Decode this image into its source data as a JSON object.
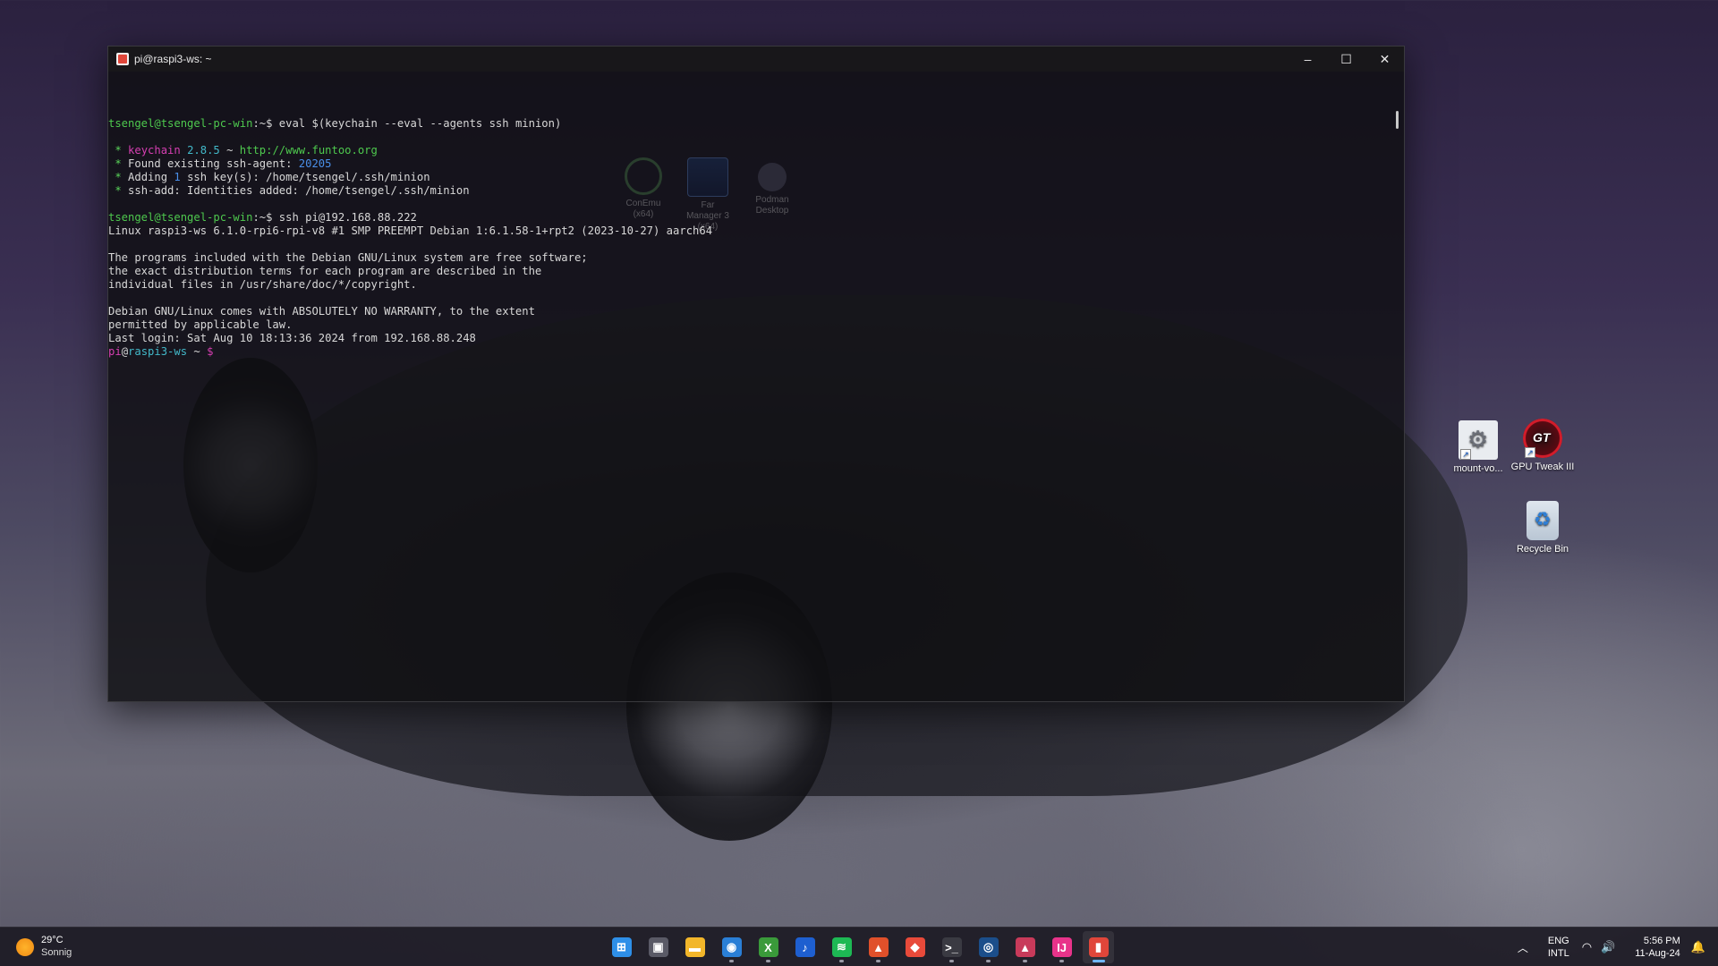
{
  "window": {
    "title": "pi@raspi3-ws: ~",
    "controls": {
      "minimize": "–",
      "maximize": "☐",
      "close": "✕"
    }
  },
  "terminal_lines": [
    [
      {
        "t": "tsengel@tsengel-pc-win",
        "c": "g"
      },
      {
        "t": ":~$ ",
        "c": "w"
      },
      {
        "t": "eval $(keychain --eval --agents ssh minion)",
        "c": "w"
      }
    ],
    [],
    [
      {
        "t": " * ",
        "c": "gb"
      },
      {
        "t": "keychain",
        "c": "m"
      },
      {
        "t": " ",
        "c": "w"
      },
      {
        "t": "2.8.5",
        "c": "c"
      },
      {
        "t": " ~ ",
        "c": "w"
      },
      {
        "t": "http://www.funtoo.org",
        "c": "g"
      }
    ],
    [
      {
        "t": " * ",
        "c": "gb"
      },
      {
        "t": "Found existing ssh-agent: ",
        "c": "w"
      },
      {
        "t": "20205",
        "c": "b"
      }
    ],
    [
      {
        "t": " * ",
        "c": "gb"
      },
      {
        "t": "Adding ",
        "c": "w"
      },
      {
        "t": "1",
        "c": "b"
      },
      {
        "t": " ssh key(s): /home/tsengel/.ssh/minion",
        "c": "w"
      }
    ],
    [
      {
        "t": " * ",
        "c": "gb"
      },
      {
        "t": "ssh-add: Identities added: /home/tsengel/.ssh/minion",
        "c": "w"
      }
    ],
    [],
    [
      {
        "t": "tsengel@tsengel-pc-win",
        "c": "g"
      },
      {
        "t": ":~$ ",
        "c": "w"
      },
      {
        "t": "ssh pi@192.168.88.222",
        "c": "w"
      }
    ],
    [
      {
        "t": "Linux raspi3-ws 6.1.0-rpi6-rpi-v8 #1 SMP PREEMPT Debian 1:6.1.58-1+rpt2 (2023-10-27) aarch64",
        "c": "w"
      }
    ],
    [],
    [
      {
        "t": "The programs included with the Debian GNU/Linux system are free software;",
        "c": "w"
      }
    ],
    [
      {
        "t": "the exact distribution terms for each program are described in the",
        "c": "w"
      }
    ],
    [
      {
        "t": "individual files in /usr/share/doc/*/copyright.",
        "c": "w"
      }
    ],
    [],
    [
      {
        "t": "Debian GNU/Linux comes with ABSOLUTELY NO WARRANTY, to the extent",
        "c": "w"
      }
    ],
    [
      {
        "t": "permitted by applicable law.",
        "c": "w"
      }
    ],
    [
      {
        "t": "Last login: Sat Aug 10 18:13:36 2024 from 192.168.88.248",
        "c": "w"
      }
    ],
    [
      {
        "t": "pi",
        "c": "m"
      },
      {
        "t": "@",
        "c": "w"
      },
      {
        "t": "raspi3-ws",
        "c": "c"
      },
      {
        "t": " ~ ",
        "c": "w"
      },
      {
        "t": "$",
        "c": "m"
      }
    ]
  ],
  "ghost_icons": [
    {
      "label": "ConEmu (x64)",
      "icon": "conemu-icon"
    },
    {
      "label": "Far Manager 3 (x64)",
      "icon": "far-manager-icon"
    },
    {
      "label": "Podman Desktop",
      "icon": "podman-icon"
    }
  ],
  "desktop_icons": {
    "mount": {
      "label": "mount-vo...",
      "icon": "gear-icon"
    },
    "gpu": {
      "label": "GPU Tweak III",
      "icon": "gpu-tweak-icon"
    },
    "bin": {
      "label": "Recycle Bin",
      "icon": "recycle-bin-icon"
    }
  },
  "weather": {
    "temp": "29°C",
    "condition": "Sonnig"
  },
  "taskbar_apps": [
    {
      "name": "start",
      "glyph": "⊞",
      "color": "#2e8fe8",
      "active": false,
      "running": false
    },
    {
      "name": "task-view",
      "glyph": "▣",
      "color": "#5a5a66",
      "active": false,
      "running": false
    },
    {
      "name": "file-explorer",
      "glyph": "▬",
      "color": "#f2b62a",
      "active": false,
      "running": false
    },
    {
      "name": "edge-browser",
      "glyph": "◉",
      "color": "#2a7fd6",
      "active": false,
      "running": true
    },
    {
      "name": "xbox",
      "glyph": "X",
      "color": "#3a9a3a",
      "active": false,
      "running": true
    },
    {
      "name": "tiktok-music",
      "glyph": "♪",
      "color": "#1e5fd0",
      "active": false,
      "running": false
    },
    {
      "name": "spotify",
      "glyph": "≋",
      "color": "#1db954",
      "active": false,
      "running": true
    },
    {
      "name": "brave-browser",
      "glyph": "▲",
      "color": "#e0502a",
      "active": false,
      "running": true
    },
    {
      "name": "maps",
      "glyph": "◆",
      "color": "#e84a3a",
      "active": false,
      "running": false
    },
    {
      "name": "windows-terminal",
      "glyph": ">_",
      "color": "#3a3a42",
      "active": false,
      "running": true
    },
    {
      "name": "steam",
      "glyph": "◎",
      "color": "#1b4e8a",
      "active": false,
      "running": true
    },
    {
      "name": "brave-beta",
      "glyph": "▲",
      "color": "#c83a5a",
      "active": false,
      "running": true
    },
    {
      "name": "jetbrains",
      "glyph": "IJ",
      "color": "#e8338a",
      "active": false,
      "running": true
    },
    {
      "name": "conemu-active",
      "glyph": "▮",
      "color": "#e0463a",
      "active": true,
      "running": true
    }
  ],
  "tray": {
    "language_top": "ENG",
    "language_bottom": "INTL",
    "time": "5:56 PM",
    "date": "11-Aug-24"
  }
}
